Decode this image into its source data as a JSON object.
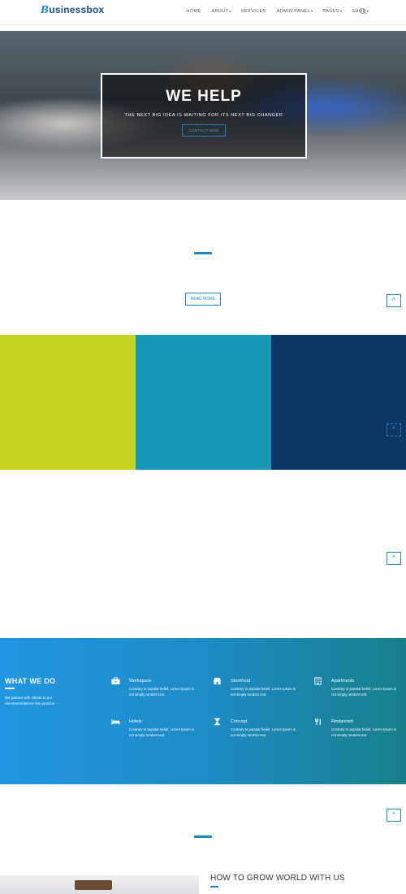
{
  "header": {
    "logo_first": "B",
    "logo_rest": "usinessbox",
    "nav": [
      {
        "label": "HOME",
        "caret": ""
      },
      {
        "label": "ABOUT",
        "caret": "▾"
      },
      {
        "label": "SERVICES",
        "caret": ""
      },
      {
        "label": "ADMIN PANEL",
        "caret": "▾"
      },
      {
        "label": "PAGES",
        "caret": "▾"
      },
      {
        "label": "SHOP",
        "caret": "▾"
      }
    ]
  },
  "hero": {
    "title": "WE HELP",
    "subtitle": "THE NEXT BIG IDEA IS WAITING FOR ITS NEXT BIG CHANGER",
    "button": "CONTACT NOW"
  },
  "intro": {
    "read_more": "READ MORE"
  },
  "up_icon": "^",
  "colors": {
    "accent": "#1e88c7",
    "block1": "#c6d41f",
    "block2": "#1599b6",
    "block3": "#0e3764"
  },
  "what_we_do": {
    "title": "WHAT WE DO",
    "description": "We partner with clients to put recommendations into practice.",
    "services": [
      {
        "icon": "briefcase-icon",
        "title": "Workspace",
        "desc": "Contrary to popular belief, Lorem Ipsum is not simply random text."
      },
      {
        "icon": "storefront-icon",
        "title": "Storefront",
        "desc": "Contrary to popular belief, Lorem Ipsum is not simply random text."
      },
      {
        "icon": "building-icon",
        "title": "Apartments",
        "desc": "Contrary to popular belief, Lorem Ipsum is not simply random text."
      },
      {
        "icon": "bed-icon",
        "title": "Hotels",
        "desc": "Contrary to popular belief, Lorem Ipsum is not simply random text."
      },
      {
        "icon": "hourglass-icon",
        "title": "Concept",
        "desc": "Contrary to popular belief, Lorem Ipsum is not simply random text."
      },
      {
        "icon": "cutlery-icon",
        "title": "Restaurant",
        "desc": "Contrary to popular belief, Lorem Ipsum is not simply random text."
      }
    ]
  },
  "bottom": {
    "title": "HOW TO GROW WORLD WITH US"
  }
}
